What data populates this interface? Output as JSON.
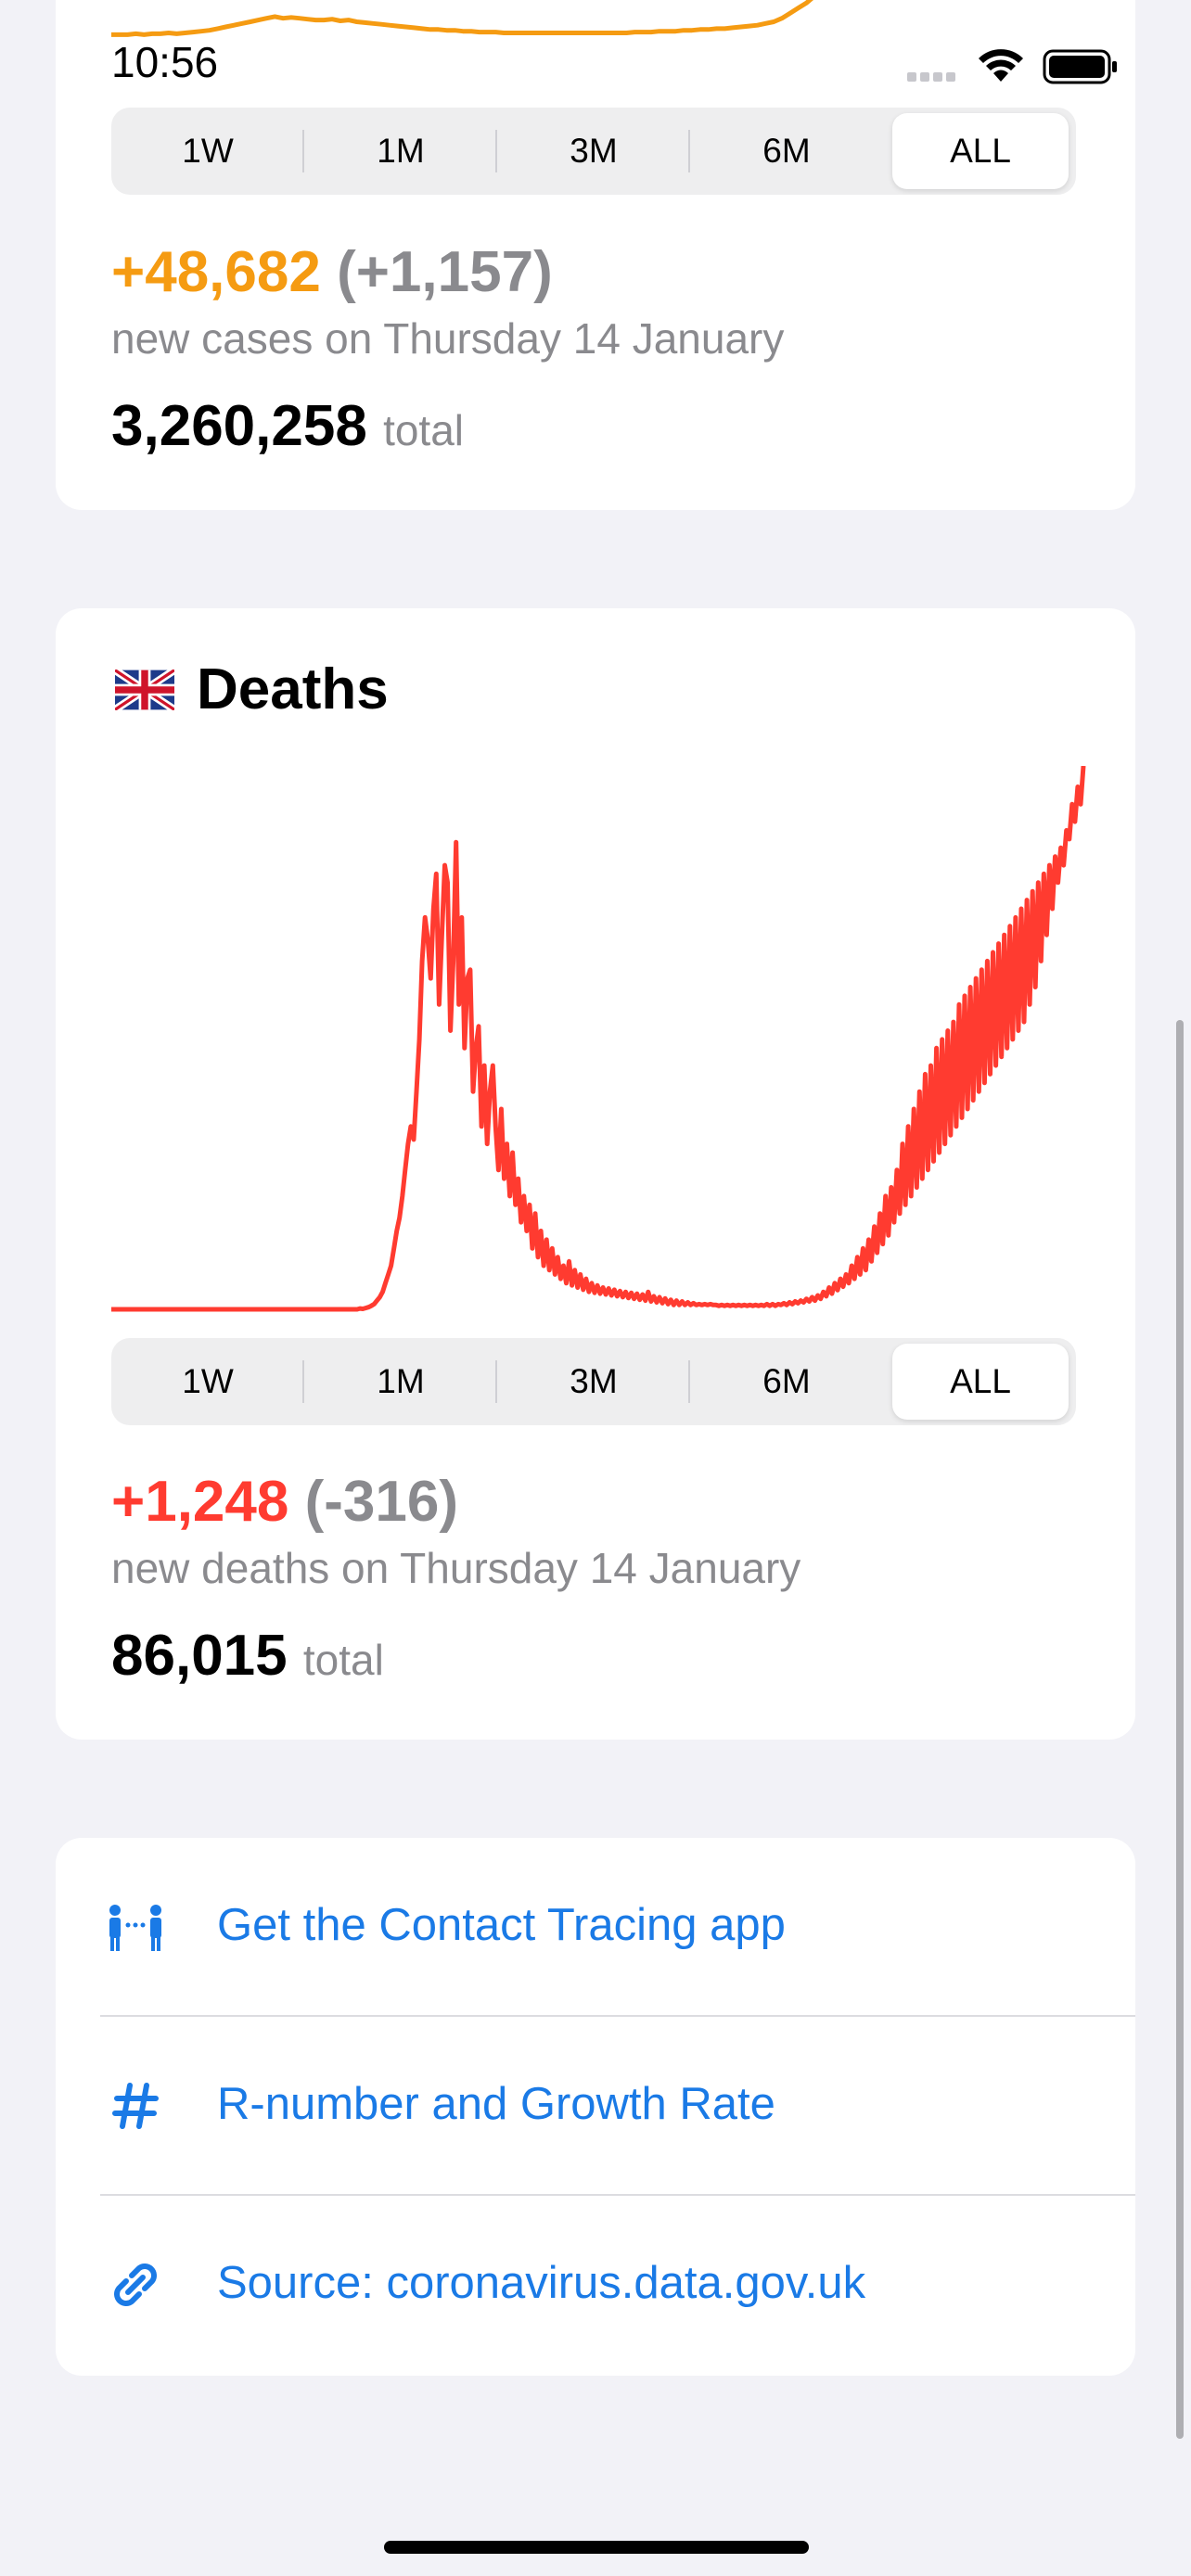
{
  "status_bar": {
    "time": "10:56"
  },
  "cases_card": {
    "ranges": [
      "1W",
      "1M",
      "3M",
      "6M",
      "ALL"
    ],
    "selected_range": "ALL",
    "new_value": "+48,682",
    "change": "(+1,157)",
    "subtitle": "new cases on Thursday 14 January",
    "total": "3,260,258",
    "total_word": "total",
    "color": "#f59b12"
  },
  "deaths_card": {
    "flag_icon": "uk-flag-icon",
    "title": "Deaths",
    "ranges": [
      "1W",
      "1M",
      "3M",
      "6M",
      "ALL"
    ],
    "selected_range": "ALL",
    "new_value": "+1,248",
    "change": "(-316)",
    "subtitle": "new deaths on Thursday 14 January",
    "total": "86,015",
    "total_word": "total",
    "color": "#ff3b30"
  },
  "links": [
    {
      "icon": "contact-tracing-icon",
      "label": "Get the Contact Tracing app"
    },
    {
      "icon": "hash-icon",
      "label": "R-number and Growth Rate"
    },
    {
      "icon": "link-icon",
      "label": "Source: coronavirus.data.gov.uk"
    }
  ],
  "colors": {
    "accent": "#1a7ae6",
    "background": "#f2f2f7"
  },
  "chart_data": [
    {
      "type": "line",
      "title": "",
      "series": [
        {
          "values": [
            5,
            5,
            5,
            6,
            5,
            6,
            6,
            7,
            6,
            7,
            8,
            9,
            10,
            12,
            14,
            16,
            18,
            20,
            22,
            24,
            26,
            24,
            25,
            24,
            23,
            22,
            22,
            23,
            21,
            22,
            20,
            19,
            18,
            17,
            16,
            15,
            14,
            13,
            12,
            11,
            11,
            10,
            10,
            9,
            9,
            8,
            8,
            8,
            7,
            7,
            7,
            7,
            7,
            7,
            7,
            7,
            7,
            7,
            7,
            7,
            7,
            7,
            7,
            7,
            8,
            8,
            8,
            9,
            9,
            9,
            10,
            10,
            11,
            11,
            12,
            12,
            13,
            14,
            15,
            16,
            18,
            20,
            24,
            30,
            36,
            42,
            50,
            58,
            66,
            74,
            82,
            90,
            100,
            110
          ]
        }
      ]
    },
    {
      "type": "line",
      "title": "Deaths",
      "series": [
        {
          "values": [
            0,
            0,
            0,
            0,
            0,
            0,
            0,
            0,
            0,
            0,
            0,
            0,
            0,
            0,
            0,
            0,
            0,
            0,
            0,
            0,
            0,
            0,
            0,
            0,
            0,
            0,
            0,
            0,
            0,
            0,
            0,
            0,
            0,
            0,
            0,
            0,
            0,
            0,
            0,
            0,
            0,
            0,
            0,
            0,
            0,
            0,
            0,
            0,
            0,
            0,
            0,
            0,
            0,
            0,
            0,
            0,
            0,
            0,
            0,
            0,
            0,
            0,
            0,
            0,
            0,
            0,
            0,
            0,
            0,
            0,
            0,
            0,
            0,
            0,
            0,
            0,
            0,
            0,
            0,
            0,
            0,
            0,
            0,
            0,
            0,
            0,
            0,
            0,
            2,
            1,
            3,
            5,
            8,
            12,
            20,
            28,
            40,
            60,
            80,
            100,
            140,
            180,
            210,
            260,
            320,
            380,
            420,
            390,
            500,
            620,
            800,
            900,
            850,
            760,
            920,
            1000,
            700,
            860,
            1020,
            980,
            640,
            800,
            1073,
            700,
            900,
            600,
            760,
            780,
            500,
            600,
            650,
            420,
            560,
            380,
            500,
            560,
            420,
            320,
            460,
            300,
            380,
            260,
            360,
            240,
            300,
            200,
            260,
            180,
            240,
            140,
            220,
            120,
            180,
            100,
            160,
            90,
            140,
            80,
            120,
            70,
            100,
            60,
            110,
            55,
            90,
            50,
            80,
            45,
            70,
            40,
            60,
            38,
            55,
            36,
            50,
            34,
            48,
            32,
            45,
            30,
            42,
            28,
            40,
            26,
            38,
            24,
            36,
            22,
            34,
            20,
            40,
            18,
            30,
            16,
            28,
            14,
            25,
            12,
            22,
            10,
            20,
            10,
            18,
            10,
            16,
            10,
            14,
            10,
            12,
            10,
            12,
            10,
            12,
            10,
            10,
            8,
            10,
            8,
            10,
            8,
            10,
            8,
            10,
            8,
            10,
            8,
            10,
            8,
            10,
            8,
            10,
            8,
            12,
            8,
            12,
            8,
            12,
            10,
            14,
            10,
            16,
            12,
            18,
            14,
            20,
            16,
            24,
            18,
            28,
            20,
            32,
            24,
            40,
            30,
            50,
            36,
            60,
            44,
            70,
            52,
            80,
            60,
            100,
            70,
            120,
            80,
            140,
            90,
            160,
            110,
            190,
            130,
            220,
            150,
            260,
            170,
            280,
            200,
            320,
            220,
            380,
            240,
            420,
            260,
            460,
            280,
            500,
            300,
            540,
            320,
            560,
            340,
            600,
            360,
            620,
            380,
            640,
            400,
            660,
            420,
            700,
            440,
            720,
            460,
            740,
            480,
            760,
            500,
            780,
            520,
            800,
            540,
            820,
            560,
            840,
            580,
            860,
            600,
            880,
            620,
            900,
            640,
            920,
            660,
            940,
            700,
            960,
            740,
            980,
            800,
            1000,
            860,
            1020,
            920,
            1040,
            980,
            1060,
            1020,
            1100,
            1080,
            1160,
            1120,
            1200,
            1160,
            1248
          ]
        }
      ]
    }
  ]
}
